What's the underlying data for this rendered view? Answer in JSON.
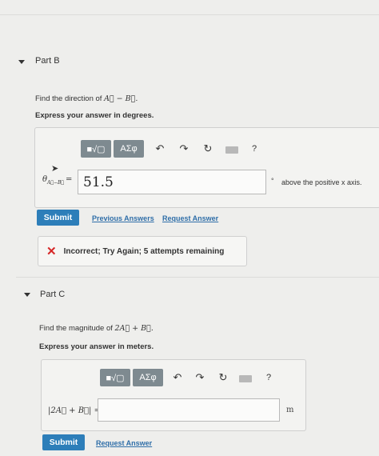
{
  "partB": {
    "title": "Part B",
    "prompt_prefix": "Find the direction of ",
    "prompt_math": "A⃗ − B⃗.",
    "express": "Express your answer in degrees.",
    "toolbar": {
      "templates": "■√▢",
      "symbols": "ΑΣφ",
      "help": "?"
    },
    "label_var": "θ",
    "label_sub": "A⃗−B⃗",
    "label_eq": "=",
    "answer_value": "51.5",
    "unit_degree": "°",
    "unit_text": "above the positive x axis.",
    "submit_label": "Submit",
    "prev_answers": "Previous Answers",
    "request_answer": "Request Answer",
    "feedback_icon": "✕",
    "feedback_text": "Incorrect; Try Again; 5 attempts remaining"
  },
  "partC": {
    "title": "Part C",
    "prompt_prefix": "Find the magnitude of ",
    "prompt_math": "2A⃗ + B⃗.",
    "express": "Express your answer in meters.",
    "toolbar": {
      "templates": "■√▢",
      "symbols": "ΑΣφ",
      "help": "?"
    },
    "label": "|2A⃗ + B⃗| =",
    "answer_value": "",
    "unit": "m",
    "submit_label": "Submit",
    "request_answer": "Request Answer"
  },
  "colors": {
    "submit": "#2d7eb9",
    "link": "#2f6ea8",
    "error": "#d62828",
    "toolbar": "#7e8a90"
  }
}
